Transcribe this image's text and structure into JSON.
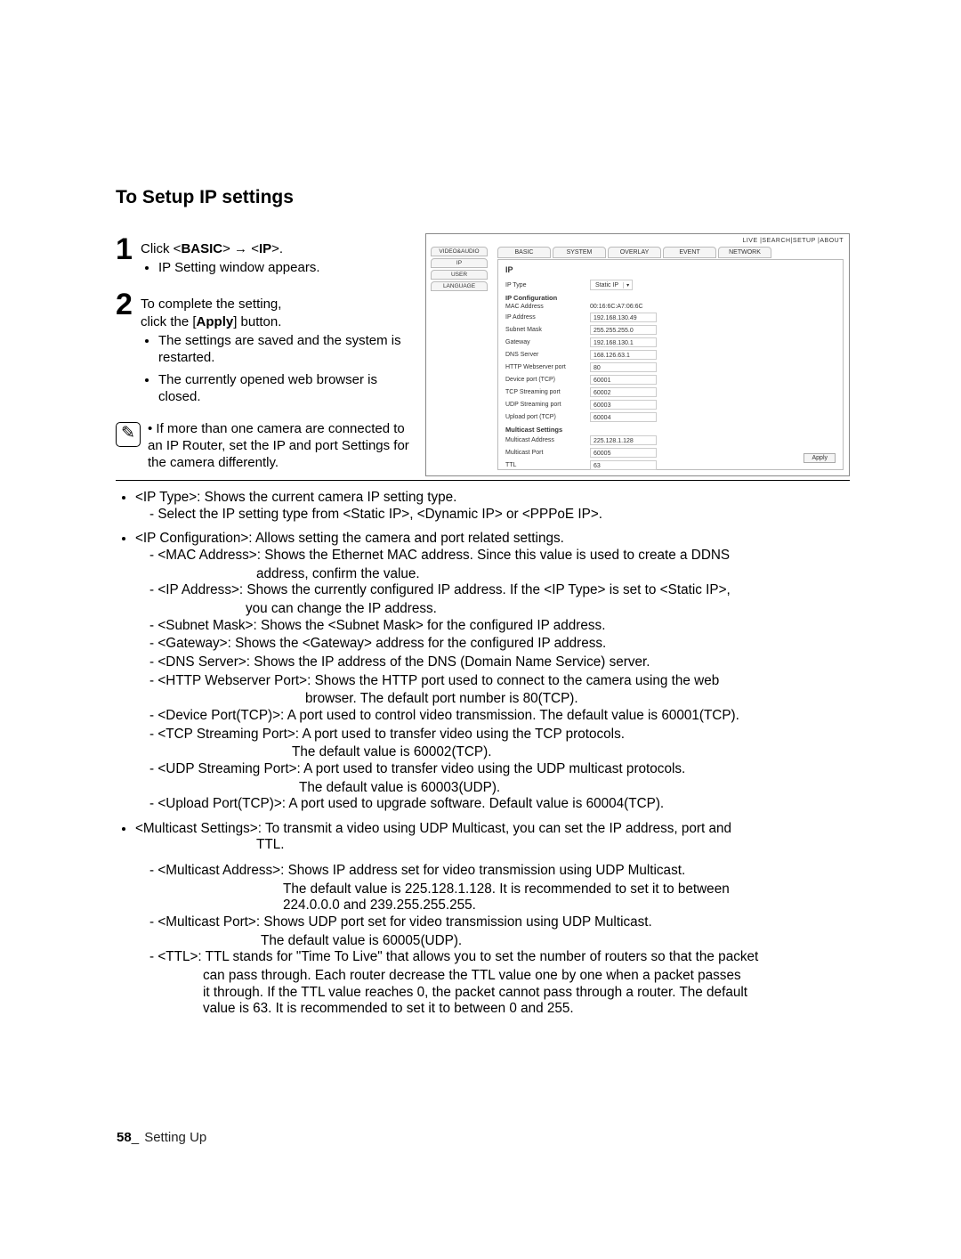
{
  "page": {
    "number": "58",
    "section": "Setting Up"
  },
  "heading": "To Setup IP settings",
  "steps": {
    "s1": {
      "text_pre": "Click <",
      "bold1": "BASIC",
      "mid": "> → <",
      "bold2": "IP",
      "post": ">.",
      "bullet1": "IP Setting window appears."
    },
    "s2": {
      "l1": "To complete the setting,",
      "l2_pre": "click the [",
      "l2_bold": "Apply",
      "l2_post": "] button.",
      "bullets": [
        "The settings are saved and the system is restarted.",
        "The currently opened web browser is closed."
      ]
    },
    "note": "If more than one camera are connected to an IP Router, set the IP and port Settings for the camera differently."
  },
  "shot": {
    "topnav": "LIVE  |SEARCH|SETUP |ABOUT",
    "tabs": [
      "BASIC",
      "SYSTEM",
      "OVERLAY",
      "EVENT",
      "NETWORK"
    ],
    "side": [
      "VIDEO&AUDIO",
      "IP",
      "USER",
      "LANGUAGE"
    ],
    "title": "IP",
    "iptype_label": "IP Type",
    "iptype_value": "Static IP",
    "conf_heading": "IP Configuration",
    "fields": [
      {
        "label": "MAC Address",
        "value": "00:16:6C:A7:06:6C"
      },
      {
        "label": "IP Address",
        "value": "192.168.130.49"
      },
      {
        "label": "Subnet Mask",
        "value": "255.255.255.0"
      },
      {
        "label": "Gateway",
        "value": "192.168.130.1"
      },
      {
        "label": "DNS Server",
        "value": "168.126.63.1"
      },
      {
        "label": "HTTP Webserver port",
        "value": "80"
      },
      {
        "label": "Device port (TCP)",
        "value": "60001"
      },
      {
        "label": "TCP Streaming port",
        "value": "60002"
      },
      {
        "label": "UDP Streaming port",
        "value": "60003"
      },
      {
        "label": "Upload port (TCP)",
        "value": "60004"
      }
    ],
    "mcast_heading": "Multicast Settings",
    "mcast": [
      {
        "label": "Multicast Address",
        "value": "225.128.1.128"
      },
      {
        "label": "Multicast Port",
        "value": "60005"
      },
      {
        "label": "TTL",
        "value": "63"
      }
    ],
    "apply": "Apply"
  },
  "defs": {
    "d1a": "<IP Type>: Shows the current camera IP setting type.",
    "d1s1": "- Select the IP setting type from <Static IP>, <Dynamic IP> or <PPPoE IP>.",
    "d2a": "<IP Configuration>: Allows setting the camera and port related settings.",
    "mac": "- <MAC Address>: Shows the Ethernet MAC address. Since this value is used to create a DDNS",
    "mac2": "address, confirm the value.",
    "ip": "- <IP Address>: Shows the currently configured IP address. If the <IP Type> is set to <Static IP>,",
    "ip2": "you can change the IP address.",
    "sm": "- <Subnet Mask>: Shows the <Subnet Mask> for the configured IP address.",
    "gw": "- <Gateway>: Shows the <Gateway> address for the configured IP address.",
    "dns": "- <DNS Server>: Shows the IP address of the DNS (Domain Name Service) server.",
    "http": "- <HTTP Webserver Port>: Shows the HTTP port used to connect to the camera using the web",
    "http2": "browser. The default port number is 80(TCP).",
    "dev": "- <Device Port(TCP)>: A port used to control video transmission. The default value is 60001(TCP).",
    "tcp": "- <TCP Streaming Port>: A port used to transfer video using the TCP protocols.",
    "tcp2": "The default value is 60002(TCP).",
    "udp": "- <UDP Streaming Port>: A port used to transfer video using the UDP multicast protocols.",
    "udp2": "The default value is 60003(UDP).",
    "up": "- <Upload Port(TCP)>: A port used to upgrade software. Default value is 60004(TCP).",
    "mc": "<Multicast Settings>: To transmit a video using UDP Multicast, you can set the IP address, port and",
    "mc_b": "TTL.",
    "ma": "- <Multicast Address>: Shows IP address set for video transmission using UDP Multicast.",
    "ma2": "The default value is 225.128.1.128. It is recommended to set it to between",
    "ma3": "224.0.0.0 and 239.255.255.255.",
    "mp": "- <Multicast Port>: Shows UDP port set for video transmission using UDP Multicast.",
    "mp2": "The default value is 60005(UDP).",
    "ttl": "- <TTL>: TTL stands for \"Time To Live\" that allows you to set the number of routers so that the packet",
    "ttl2": "can pass through. Each router decrease the TTL value one by one when a packet passes",
    "ttl3": "it through. If the TTL value reaches 0, the packet cannot pass through a router. The default",
    "ttl4": "value is 63. It is recommended to set it to between 0 and 255."
  }
}
